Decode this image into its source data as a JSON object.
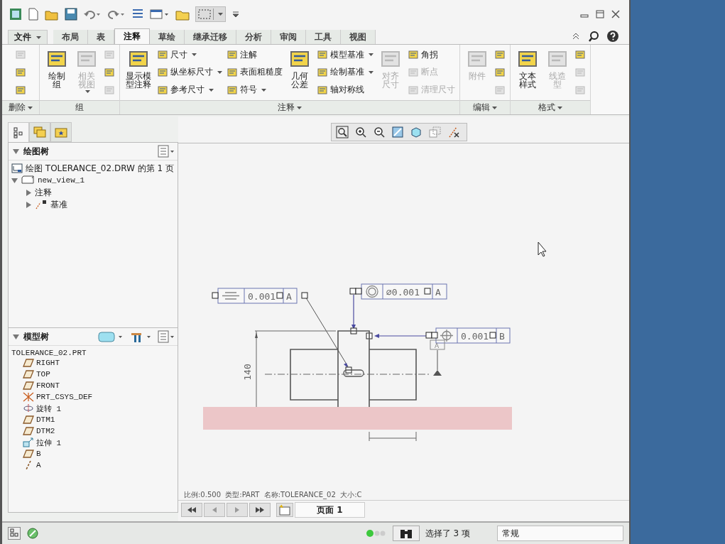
{
  "file_menu": {
    "label": "文件"
  },
  "tabs": [
    {
      "label": "布局",
      "selected": false
    },
    {
      "label": "表",
      "selected": false
    },
    {
      "label": "注释",
      "selected": true
    },
    {
      "label": "草绘",
      "selected": false
    },
    {
      "label": "继承迁移",
      "selected": false
    },
    {
      "label": "分析",
      "selected": false
    },
    {
      "label": "审阅",
      "selected": false
    },
    {
      "label": "工具",
      "selected": false
    },
    {
      "label": "视图",
      "selected": false
    }
  ],
  "ribbon": {
    "groups": [
      {
        "label": "删除",
        "dropdown": true,
        "columns": [
          {
            "kind": "stack",
            "items": [
              {
                "disabled": true,
                "dropdown": false
              },
              {
                "disabled": false,
                "dropdown": false
              },
              {
                "disabled": false,
                "dropdown": false
              }
            ]
          }
        ]
      },
      {
        "label": "组",
        "dropdown": false,
        "columns": [
          {
            "kind": "large",
            "label": "绘制组",
            "disabled": false,
            "dropdown": false
          },
          {
            "kind": "large",
            "label": "相关视图",
            "disabled": true,
            "dropdown": true
          },
          {
            "kind": "stack",
            "items": [
              {
                "disabled": true,
                "dropdown": false
              },
              {
                "disabled": false,
                "dropdown": false
              },
              {
                "disabled": true,
                "dropdown": false
              }
            ]
          }
        ]
      },
      {
        "label": "注释",
        "dropdown": true,
        "columns": [
          {
            "kind": "large",
            "label": "显示模型注释",
            "disabled": false,
            "dropdown": false
          },
          {
            "kind": "stack",
            "items": [
              {
                "label": "尺寸",
                "disabled": false,
                "dropdown": true
              },
              {
                "label": "纵坐标尺寸",
                "disabled": false,
                "dropdown": true
              },
              {
                "label": "参考尺寸",
                "disabled": false,
                "dropdown": true
              }
            ]
          },
          {
            "kind": "stack",
            "items": [
              {
                "label": "注解",
                "disabled": false,
                "dropdown": false
              },
              {
                "label": "表面粗糙度",
                "disabled": false,
                "dropdown": false
              },
              {
                "label": "符号",
                "disabled": false,
                "dropdown": true
              }
            ]
          },
          {
            "kind": "large",
            "label": "几何公差",
            "disabled": false,
            "dropdown": false
          },
          {
            "kind": "stack",
            "items": [
              {
                "label": "模型基准",
                "disabled": false,
                "dropdown": true
              },
              {
                "label": "绘制基准",
                "disabled": false,
                "dropdown": true
              },
              {
                "label": "轴对称线",
                "disabled": false,
                "dropdown": false
              }
            ]
          },
          {
            "kind": "large",
            "label": "对齐尺寸",
            "disabled": true,
            "dropdown": false
          },
          {
            "kind": "stack",
            "items": [
              {
                "label": "角拐",
                "disabled": false,
                "dropdown": false
              },
              {
                "label": "断点",
                "disabled": true,
                "dropdown": false
              },
              {
                "label": "清理尺寸",
                "disabled": true,
                "dropdown": false
              }
            ]
          }
        ]
      },
      {
        "label": "编辑",
        "dropdown": true,
        "columns": [
          {
            "kind": "large",
            "label": "附件",
            "disabled": true,
            "dropdown": false
          },
          {
            "kind": "stack",
            "items": [
              {
                "disabled": false,
                "dropdown": false
              },
              {
                "disabled": false,
                "dropdown": false
              },
              {
                "disabled": true,
                "dropdown": false
              }
            ]
          }
        ]
      },
      {
        "label": "格式",
        "dropdown": true,
        "columns": [
          {
            "kind": "large",
            "label": "文本样式",
            "disabled": false,
            "dropdown": false
          },
          {
            "kind": "large",
            "label": "线造型",
            "disabled": true,
            "dropdown": false
          },
          {
            "kind": "stack",
            "items": [
              {
                "disabled": false,
                "dropdown": false
              },
              {
                "disabled": true,
                "dropdown": false
              },
              {
                "disabled": true,
                "dropdown": false
              }
            ]
          }
        ]
      }
    ]
  },
  "drawing_tree": {
    "title": "绘图树",
    "items": [
      {
        "label": "绘图 TOLERANCE_02.DRW 的第 1 页",
        "kind": "sheet"
      },
      {
        "label": "new_view_1",
        "kind": "view",
        "expanded": true,
        "children": [
          {
            "label": "注释",
            "kind": "folder",
            "expanded": false
          },
          {
            "label": "基准",
            "kind": "datum",
            "expanded": false
          }
        ]
      }
    ]
  },
  "model_tree": {
    "title": "模型树",
    "root": "TOLERANCE_02.PRT",
    "items": [
      {
        "label": "RIGHT",
        "kind": "plane"
      },
      {
        "label": "TOP",
        "kind": "plane"
      },
      {
        "label": "FRONT",
        "kind": "plane"
      },
      {
        "label": "PRT_CSYS_DEF",
        "kind": "csys"
      },
      {
        "label": "旋转 1",
        "kind": "revolve"
      },
      {
        "label": "DTM1",
        "kind": "plane"
      },
      {
        "label": "DTM2",
        "kind": "plane"
      },
      {
        "label": "拉伸 1",
        "kind": "extrude"
      },
      {
        "label": "B",
        "kind": "plane"
      },
      {
        "label": "A",
        "kind": "axis"
      }
    ]
  },
  "drawing": {
    "frames": [
      {
        "kind": "symmetry",
        "value": "0.001",
        "datum": "A"
      },
      {
        "kind": "concentricity",
        "value": "∅0.001",
        "datum": "A"
      },
      {
        "kind": "position",
        "value": "0.001",
        "datum": "B"
      }
    ],
    "datum_feature": "A",
    "dimension": "140"
  },
  "sheet_info": "比例:0.500  类型:PART  名称:TOLERANCE_02  大小:C",
  "page_tab": "页面 1",
  "status": {
    "selection": "选择了 3 项",
    "filter": "常规"
  }
}
